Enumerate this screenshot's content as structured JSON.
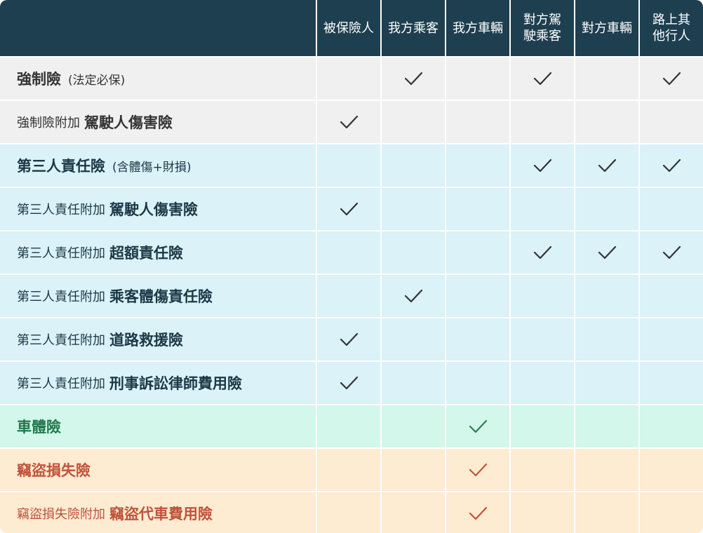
{
  "columns": [
    "",
    "被保險人",
    "我方乘客",
    "我方車輛",
    "對方駕\n駛乘客",
    "對方車輛",
    "路上其\n他行人"
  ],
  "colors": {
    "header_bg": "#1e3f4f",
    "gray_row": "#f0f0f0",
    "blue_row": "#daf2f8",
    "green_row": "#d3f7ea",
    "orange_row": "#fdebd2",
    "check_dark": "#333333",
    "check_green": "#2e7d55",
    "check_orange": "#c0533a"
  },
  "rows": [
    {
      "theme": "gray",
      "main": "強制險",
      "note": "(法定必保)",
      "checks": [
        false,
        true,
        false,
        true,
        false,
        true
      ]
    },
    {
      "theme": "gray",
      "prefix": "強制險附加",
      "main": "駕駛人傷害險",
      "checks": [
        true,
        false,
        false,
        false,
        false,
        false
      ]
    },
    {
      "theme": "blue",
      "main": "第三人責任險",
      "note": "(含體傷+財損)",
      "checks": [
        false,
        false,
        false,
        true,
        true,
        true
      ]
    },
    {
      "theme": "blue",
      "prefix": "第三人責任附加",
      "main": "駕駛人傷害險",
      "checks": [
        true,
        false,
        false,
        false,
        false,
        false
      ]
    },
    {
      "theme": "blue",
      "prefix": "第三人責任附加",
      "main": "超額責任險",
      "checks": [
        false,
        false,
        false,
        true,
        true,
        true
      ]
    },
    {
      "theme": "blue",
      "prefix": "第三人責任附加",
      "main": "乘客體傷責任險",
      "checks": [
        false,
        true,
        false,
        false,
        false,
        false
      ]
    },
    {
      "theme": "blue",
      "prefix": "第三人責任附加",
      "main": "道路救援險",
      "checks": [
        true,
        false,
        false,
        false,
        false,
        false
      ]
    },
    {
      "theme": "blue",
      "prefix": "第三人責任附加",
      "main": "刑事訴訟律師費用險",
      "checks": [
        true,
        false,
        false,
        false,
        false,
        false
      ]
    },
    {
      "theme": "green",
      "main": "車體險",
      "checks": [
        false,
        false,
        true,
        false,
        false,
        false
      ]
    },
    {
      "theme": "orange",
      "main": "竊盜損失險",
      "checks": [
        false,
        false,
        true,
        false,
        false,
        false
      ]
    },
    {
      "theme": "orange",
      "prefix": "竊盜損失險附加",
      "main": "竊盜代車費用險",
      "checks": [
        false,
        false,
        true,
        false,
        false,
        false
      ]
    }
  ]
}
